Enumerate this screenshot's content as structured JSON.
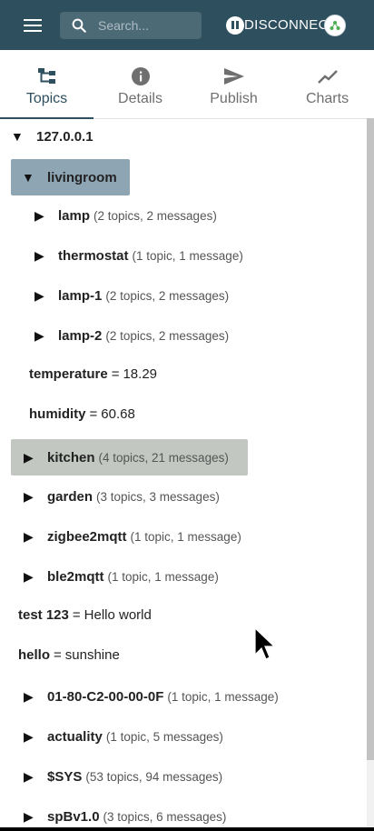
{
  "search": {
    "placeholder": "Search..."
  },
  "appbar": {
    "disconnect_label": "DISCONNECT"
  },
  "tabs": [
    {
      "label": "Topics",
      "icon": "topics-icon",
      "active": true
    },
    {
      "label": "Details",
      "icon": "info-icon",
      "active": false
    },
    {
      "label": "Publish",
      "icon": "send-icon",
      "active": false
    },
    {
      "label": "Charts",
      "icon": "chart-icon",
      "active": false
    }
  ],
  "tree": {
    "root": "127.0.0.1",
    "livingroom": {
      "name": "livingroom",
      "children": [
        {
          "name": "lamp",
          "meta": "(2 topics, 2 messages)"
        },
        {
          "name": "thermostat",
          "meta": "(1 topic, 1 message)"
        },
        {
          "name": "lamp-1",
          "meta": "(2 topics, 2 messages)"
        },
        {
          "name": "lamp-2",
          "meta": "(2 topics, 2 messages)"
        }
      ],
      "values": [
        {
          "name": "temperature",
          "value": "18.29"
        },
        {
          "name": "humidity",
          "value": "60.68"
        }
      ]
    },
    "branches": [
      {
        "name": "kitchen",
        "meta": "(4 topics, 21 messages)"
      },
      {
        "name": "garden",
        "meta": "(3 topics, 3 messages)"
      },
      {
        "name": "zigbee2mqtt",
        "meta": "(1 topic, 1 message)"
      },
      {
        "name": "ble2mqtt",
        "meta": "(1 topic, 1 message)"
      }
    ],
    "root_values": [
      {
        "name": "test 123",
        "value": "Hello world"
      },
      {
        "name": "hello",
        "value": "sunshine"
      }
    ],
    "more_branches": [
      {
        "name": "01-80-C2-00-00-0F",
        "meta": "(1 topic, 1 message)"
      },
      {
        "name": "actuality",
        "meta": "(1 topic, 5 messages)"
      },
      {
        "name": "$SYS",
        "meta": "(53 topics, 94 messages)"
      },
      {
        "name": "spBv1.0",
        "meta": "(3 topics, 6 messages)"
      }
    ]
  },
  "symbols": {
    "expanded": "▼",
    "collapsed": "▶",
    "equals": "="
  },
  "colors": {
    "appbar": "#2d4f5e",
    "selected_blue": "#8ea6b4",
    "selected_green": "#c2c7c2"
  }
}
